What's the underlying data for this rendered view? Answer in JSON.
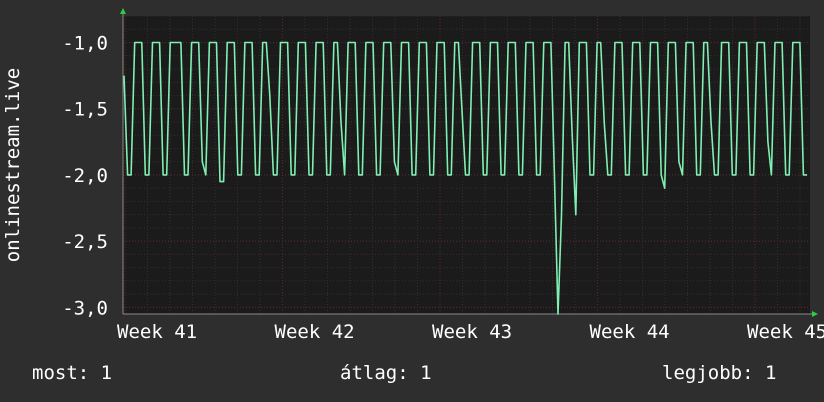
{
  "chart_data": {
    "type": "line",
    "ylabel": "onlinestream.live",
    "x_ticks": [
      "Week 41",
      "Week 42",
      "Week 43",
      "Week 44",
      "Week 45"
    ],
    "y_ticks": [
      "-1,0",
      "-1,5",
      "-2,0",
      "-2,5",
      "-3,0"
    ],
    "ylim": [
      -3.05,
      -0.8
    ],
    "grid": true,
    "colors": {
      "background": "#2e2e2e",
      "plot": "#1b1b1b",
      "line": "#7fefb2",
      "grid": "#5a2a2a",
      "axis_arrow": "#2ecc40"
    },
    "series": [
      {
        "values": [
          -1.25,
          -2,
          -2,
          -1,
          -1,
          -1,
          -2,
          -2,
          -1,
          -1,
          -1,
          -2,
          -2,
          -1,
          -1,
          -1,
          -1,
          -2,
          -2,
          -1,
          -1,
          -1,
          -1.9,
          -2,
          -1,
          -1,
          -1,
          -2.05,
          -2.05,
          -1,
          -1,
          -1,
          -2,
          -2,
          -1,
          -1,
          -1,
          -2,
          -2,
          -1,
          -1,
          -1.4,
          -2,
          -2,
          -1,
          -1,
          -1,
          -2,
          -2,
          -1,
          -1,
          -1,
          -2,
          -2,
          -1,
          -1,
          -1,
          -2,
          -2,
          -1,
          -1,
          -1.6,
          -2,
          -1,
          -1,
          -1,
          -2,
          -2,
          -1,
          -1,
          -1,
          -2,
          -2,
          -1,
          -1,
          -1,
          -1.9,
          -2,
          -1,
          -1,
          -1,
          -2,
          -2,
          -1,
          -1,
          -1,
          -2,
          -2,
          -1,
          -1,
          -1,
          -2,
          -2,
          -1,
          -1,
          -1.5,
          -2,
          -2,
          -1,
          -1,
          -1,
          -2,
          -2,
          -1,
          -1,
          -1,
          -2,
          -2,
          -1,
          -1,
          -1,
          -2,
          -2,
          -1,
          -1,
          -1,
          -2,
          -2,
          -1,
          -1,
          -1,
          -2,
          -3.05,
          -2.3,
          -1,
          -1,
          -1.7,
          -2.3,
          -1,
          -1,
          -1,
          -2,
          -2,
          -1,
          -1,
          -1.6,
          -2,
          -2,
          -1,
          -1,
          -1,
          -2,
          -2,
          -1,
          -1,
          -1,
          -2,
          -2,
          -1,
          -1,
          -1,
          -2,
          -2.1,
          -1,
          -1,
          -1,
          -1.9,
          -2,
          -1,
          -1,
          -1,
          -2,
          -2,
          -1,
          -1,
          -1.6,
          -2,
          -2,
          -1,
          -1,
          -1,
          -2,
          -2,
          -1,
          -1,
          -1,
          -2,
          -2,
          -1,
          -1,
          -1,
          -1.75,
          -2,
          -1,
          -1,
          -1,
          -2,
          -2,
          -1,
          -1,
          -1,
          -2,
          -2
        ]
      }
    ]
  },
  "footer": {
    "now": "most: 1",
    "average": "átlag: 1",
    "best": "legjobb: 1"
  }
}
